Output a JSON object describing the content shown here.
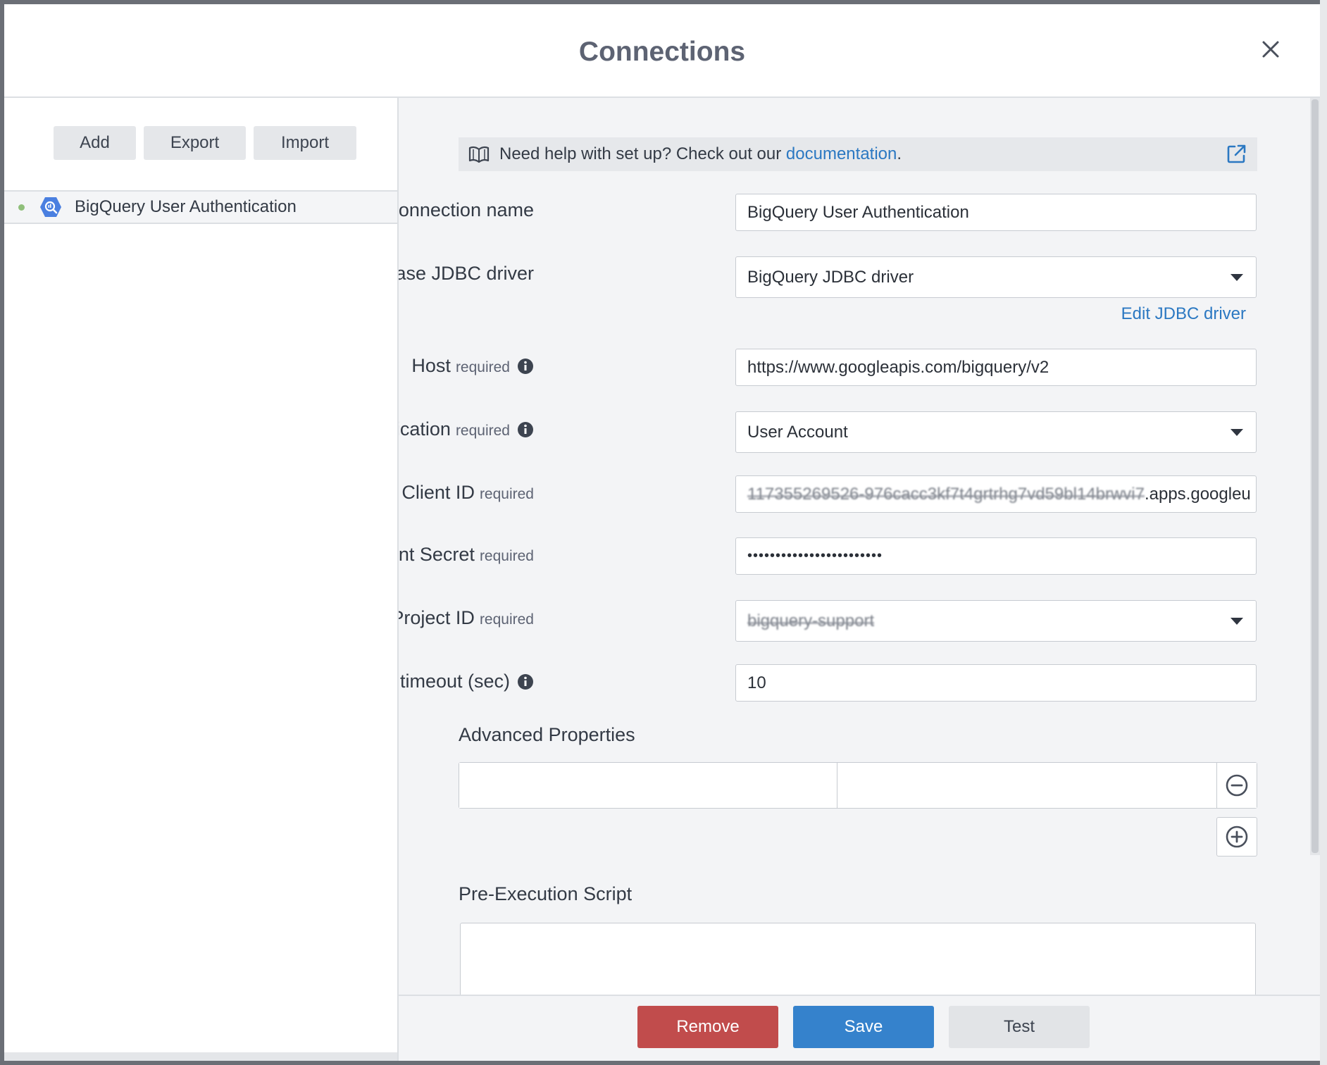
{
  "dialog": {
    "title": "Connections",
    "close_icon": "close-icon"
  },
  "sidebar": {
    "buttons": {
      "add": "Add",
      "export": "Export",
      "import": "Import"
    },
    "connections": [
      {
        "label": "BigQuery User Authentication",
        "icon": "bigquery-icon",
        "status_color": "#8fbf7a"
      }
    ]
  },
  "help": {
    "prefix": "Need help with set up? Check out our ",
    "link": "documentation",
    "suffix": ".",
    "icons": [
      "book-icon",
      "external-link-icon"
    ]
  },
  "form": {
    "required_text": "required",
    "connection_name": {
      "label": "Connection name",
      "value": "BigQuery User Authentication"
    },
    "jdbc_driver": {
      "label": "Database JDBC driver",
      "value": "BigQuery JDBC driver",
      "edit_link": "Edit JDBC driver"
    },
    "host": {
      "label": "Host",
      "value": "https://www.googleapis.com/bigquery/v2"
    },
    "authentication": {
      "label": "Authentication",
      "value": "User Account"
    },
    "client_id": {
      "label": "Client ID",
      "value_redacted": "117355269526-976cacc3kf7t4grtrhg7vd59bl14brwvi7",
      "value_suffix": ".apps.googleu"
    },
    "client_secret": {
      "label": "Client Secret",
      "value": "••••••••••••••••••••••••"
    },
    "project_id": {
      "label": "Project ID",
      "value": "bigquery-support"
    },
    "timeout": {
      "label": "Connection timeout (sec)",
      "value": "10"
    }
  },
  "sections": {
    "advanced": "Advanced Properties",
    "pre_exec": "Pre-Execution Script"
  },
  "footer": {
    "remove": "Remove",
    "save": "Save",
    "test": "Test"
  },
  "colors": {
    "primary": "#3582cc",
    "danger": "#c14c4c",
    "link": "#2b78c2"
  }
}
